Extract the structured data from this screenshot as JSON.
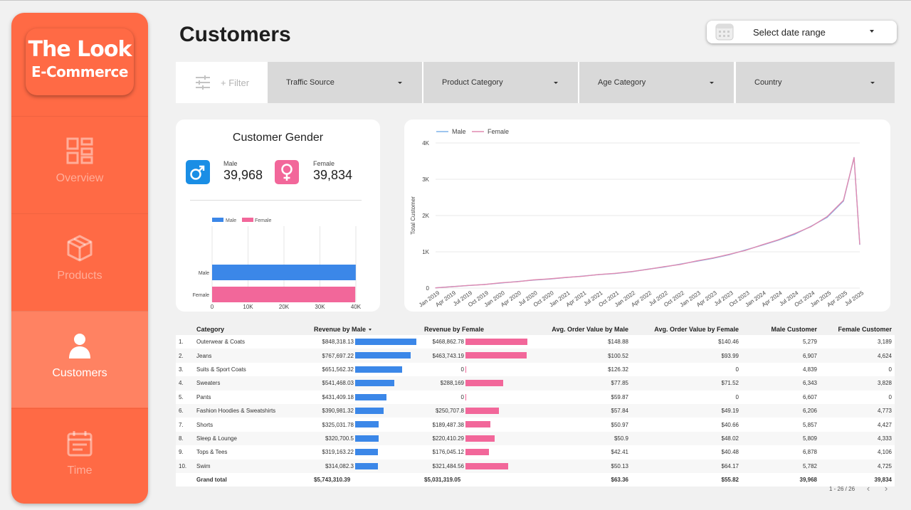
{
  "sidebar": {
    "logo_line1": "The Look",
    "logo_line2": "E-Commerce",
    "items": [
      {
        "label": "Overview",
        "icon": "dashboard-icon"
      },
      {
        "label": "Products",
        "icon": "box-icon"
      },
      {
        "label": "Customers",
        "icon": "user-icon",
        "active": true
      },
      {
        "label": "Time",
        "icon": "calendar-icon"
      }
    ]
  },
  "header": {
    "title": "Customers",
    "date_range_label": "Select date range"
  },
  "filters": {
    "add_label": "+ Filter",
    "chips": [
      "Traffic Source",
      "Product Category",
      "Age Category",
      "Country"
    ]
  },
  "gender_card": {
    "title": "Customer Gender",
    "male_label": "Male",
    "male_value": "39,968",
    "female_label": "Female",
    "female_value": "39,834"
  },
  "colors": {
    "accent": "#ff6a45",
    "male": "#3b87e8",
    "female": "#f2679a",
    "male_line": "#7fb2ea",
    "female_line": "#e08ab0"
  },
  "chart_data": [
    {
      "type": "bar",
      "orientation": "horizontal",
      "categories": [
        "Male",
        "Female"
      ],
      "values": [
        39968,
        39834
      ],
      "legend": [
        "Male",
        "Female"
      ],
      "legend_position": "top",
      "xticks": [
        "0",
        "10K",
        "20K",
        "30K",
        "40K"
      ],
      "xlim": [
        0,
        40000
      ]
    },
    {
      "type": "line",
      "ylabel": "Total Customer",
      "ylim": [
        0,
        4000
      ],
      "yticks": [
        "0",
        "1K",
        "2K",
        "3K",
        "4K"
      ],
      "legend_position": "top-left",
      "x": [
        "Jan 2019",
        "Apr 2019",
        "Jul 2019",
        "Oct 2019",
        "Jan 2020",
        "Apr 2020",
        "Jul 2020",
        "Oct 2020",
        "Jan 2021",
        "Apr 2021",
        "Jul 2021",
        "Oct 2021",
        "Jan 2022",
        "Apr 2022",
        "Jul 2022",
        "Oct 2022",
        "Jan 2023",
        "Apr 2023",
        "Jul 2023",
        "Oct 2023",
        "Jan 2024",
        "Apr 2024",
        "Jul 2024",
        "Oct 2024",
        "Jan 2025",
        "Apr 2025",
        "Jul 2025"
      ],
      "series": [
        {
          "name": "Male",
          "values": [
            5,
            40,
            70,
            100,
            140,
            180,
            220,
            250,
            290,
            330,
            370,
            400,
            450,
            520,
            580,
            660,
            740,
            820,
            920,
            1050,
            1180,
            1320,
            1480,
            1700,
            1950,
            2400,
            1200
          ]
        },
        {
          "name": "Female",
          "values": [
            5,
            38,
            72,
            98,
            145,
            175,
            225,
            255,
            295,
            325,
            375,
            405,
            455,
            515,
            590,
            650,
            750,
            830,
            930,
            1040,
            1190,
            1330,
            1500,
            1690,
            1970,
            2420,
            1210
          ]
        }
      ],
      "peak_value": 3600,
      "peak_x": "Jun 2025"
    }
  ],
  "table": {
    "headers": [
      "Category",
      "Revenue by Male",
      "Revenue by Female",
      "Avg. Order Value by Male",
      "Avg. Order Value by Female",
      "Male Customer",
      "Female Customer"
    ],
    "rows": [
      {
        "idx": "1.",
        "category": "Outerwear & Coats",
        "rev_m": "$848,318.13",
        "rev_m_num": 848318.13,
        "rev_f": "$468,862.78",
        "rev_f_num": 468862.78,
        "aov_m": "$148.88",
        "aov_f": "$140.46",
        "cust_m": "5,279",
        "cust_f": "3,189"
      },
      {
        "idx": "2.",
        "category": "Jeans",
        "rev_m": "$767,697.22",
        "rev_m_num": 767697.22,
        "rev_f": "$463,743.19",
        "rev_f_num": 463743.19,
        "aov_m": "$100.52",
        "aov_f": "$93.99",
        "cust_m": "6,907",
        "cust_f": "4,624"
      },
      {
        "idx": "3.",
        "category": "Suits & Sport Coats",
        "rev_m": "$651,562.32",
        "rev_m_num": 651562.32,
        "rev_f": "0",
        "rev_f_num": 0,
        "aov_m": "$126.32",
        "aov_f": "0",
        "cust_m": "4,839",
        "cust_f": "0"
      },
      {
        "idx": "4.",
        "category": "Sweaters",
        "rev_m": "$541,468.03",
        "rev_m_num": 541468.03,
        "rev_f": "$288,169",
        "rev_f_num": 288169,
        "aov_m": "$77.85",
        "aov_f": "$71.52",
        "cust_m": "6,343",
        "cust_f": "3,828"
      },
      {
        "idx": "5.",
        "category": "Pants",
        "rev_m": "$431,409.18",
        "rev_m_num": 431409.18,
        "rev_f": "0",
        "rev_f_num": 0,
        "aov_m": "$59.87",
        "aov_f": "0",
        "cust_m": "6,607",
        "cust_f": "0"
      },
      {
        "idx": "6.",
        "category": "Fashion Hoodies & Sweatshirts",
        "rev_m": "$390,981.32",
        "rev_m_num": 390981.32,
        "rev_f": "$250,707.8",
        "rev_f_num": 250707.8,
        "aov_m": "$57.84",
        "aov_f": "$49.19",
        "cust_m": "6,206",
        "cust_f": "4,773"
      },
      {
        "idx": "7.",
        "category": "Shorts",
        "rev_m": "$325,031.78",
        "rev_m_num": 325031.78,
        "rev_f": "$189,487.38",
        "rev_f_num": 189487.38,
        "aov_m": "$50.97",
        "aov_f": "$40.66",
        "cust_m": "5,857",
        "cust_f": "4,427"
      },
      {
        "idx": "8.",
        "category": "Sleep & Lounge",
        "rev_m": "$320,700.5",
        "rev_m_num": 320700.5,
        "rev_f": "$220,410.29",
        "rev_f_num": 220410.29,
        "aov_m": "$50.9",
        "aov_f": "$48.02",
        "cust_m": "5,809",
        "cust_f": "4,333"
      },
      {
        "idx": "9.",
        "category": "Tops & Tees",
        "rev_m": "$319,163.22",
        "rev_m_num": 319163.22,
        "rev_f": "$176,045.12",
        "rev_f_num": 176045.12,
        "aov_m": "$42.41",
        "aov_f": "$40.48",
        "cust_m": "6,878",
        "cust_f": "4,106"
      },
      {
        "idx": "10.",
        "category": "Swim",
        "rev_m": "$314,082.3",
        "rev_m_num": 314082.3,
        "rev_f": "$321,484.56",
        "rev_f_num": 321484.56,
        "aov_m": "$50.13",
        "aov_f": "$64.17",
        "cust_m": "5,782",
        "cust_f": "4,725"
      }
    ],
    "total": {
      "label": "Grand total",
      "rev_m": "$5,743,310.39",
      "rev_f": "$5,031,319.05",
      "aov_m": "$63.36",
      "aov_f": "$55.82",
      "cust_m": "39,968",
      "cust_f": "39,834"
    },
    "pagination": "1 - 26 / 26"
  }
}
